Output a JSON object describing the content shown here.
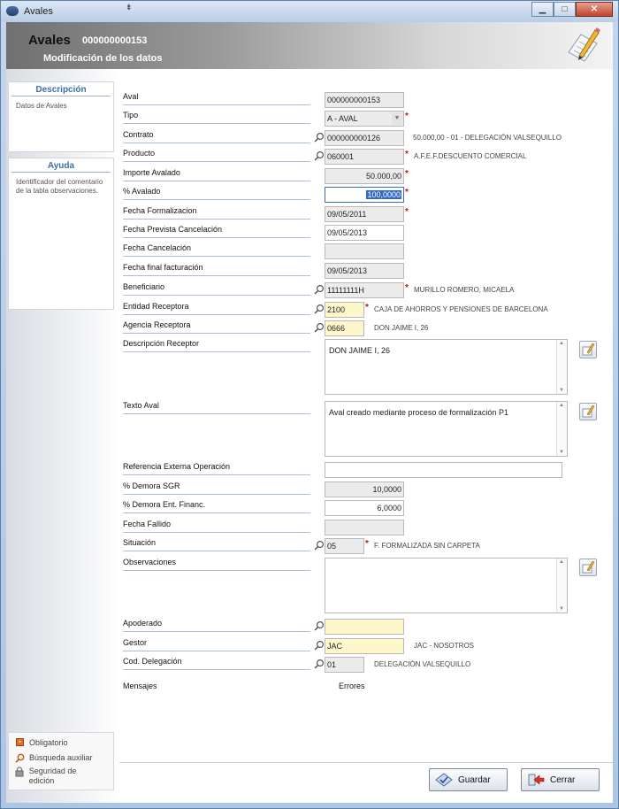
{
  "window": {
    "title": "Avales"
  },
  "header": {
    "title": "Avales",
    "id": "000000000153",
    "subtitle": "Modificación de los datos"
  },
  "sidebar": {
    "descripcion": {
      "title": "Descripción",
      "text": "Datos de Avales"
    },
    "ayuda": {
      "title": "Ayuda",
      "text": "Identificador del comentario de la tabla observaciones."
    },
    "legend": {
      "obligatorio": "Obligatorio",
      "busqueda": "Búsqueda auxiliar",
      "seguridad": "Seguridad de edición"
    }
  },
  "form": {
    "aval": {
      "label": "Aval",
      "value": "000000000153"
    },
    "tipo": {
      "label": "Tipo",
      "value": "A - AVAL"
    },
    "contrato": {
      "label": "Contrato",
      "value": "000000000126",
      "desc": "50.000,00 - 01 - DELEGACIÓN VALSEQUILLO"
    },
    "producto": {
      "label": "Producto",
      "value": "060001",
      "desc": "A.F.E.F.DESCUENTO COMERCIAL"
    },
    "importe_avalado": {
      "label": "Importe Avalado",
      "value": "50.000,00"
    },
    "pct_avalado": {
      "label": "% Avalado",
      "value": "100,0000"
    },
    "fecha_formalizacion": {
      "label": "Fecha Formalizacion",
      "value": "09/05/2011"
    },
    "fecha_prevista_cancelacion": {
      "label": "Fecha Prevista Cancelación",
      "value": "09/05/2013"
    },
    "fecha_cancelacion": {
      "label": "Fecha Cancelación",
      "value": ""
    },
    "fecha_final_facturacion": {
      "label": "Fecha final facturación",
      "value": "09/05/2013"
    },
    "beneficiario": {
      "label": "Beneficiario",
      "value": "11111111H",
      "desc": "MURILLO ROMERO, MICAELA"
    },
    "entidad_receptora": {
      "label": "Entidad Receptora",
      "value": "2100",
      "desc": "CAJA DE AHORROS Y PENSIONES DE BARCELONA"
    },
    "agencia_receptora": {
      "label": "Agencia Receptora",
      "value": "0666",
      "desc": "DON JAIME I, 26"
    },
    "descripcion_receptor": {
      "label": "Descripción Receptor",
      "value": "DON JAIME I, 26"
    },
    "texto_aval": {
      "label": "Texto Aval",
      "value": "Aval creado mediante proceso de formalización P1"
    },
    "referencia_externa": {
      "label": "Referencia Externa Operación",
      "value": ""
    },
    "demora_sgr": {
      "label": "% Demora SGR",
      "value": "10,0000"
    },
    "demora_ent": {
      "label": "% Demora Ent. Financ.",
      "value": "6,0000"
    },
    "fecha_fallido": {
      "label": "Fecha Fallido",
      "value": ""
    },
    "situacion": {
      "label": "Situación",
      "value": "05",
      "desc": "F. FORMALIZADA SIN CARPETA"
    },
    "observaciones": {
      "label": "Observaciones",
      "value": ""
    },
    "apoderado": {
      "label": "Apoderado",
      "value": ""
    },
    "gestor": {
      "label": "Gestor",
      "value": "JAC",
      "desc": "JAC - NOSOTROS"
    },
    "cod_delegacion": {
      "label": "Cod. Delegación",
      "value": "01",
      "desc": "DELEGACIÓN VALSEQUILLO"
    },
    "mensajes": {
      "label": "Mensajes"
    },
    "errores": {
      "label": "Errores"
    }
  },
  "required_mark": "*",
  "buttons": {
    "guardar": "Guardar",
    "cerrar": "Cerrar"
  },
  "colors": {
    "required": "#d01010",
    "lookup_field": "#fff7cc",
    "readonly_field": "#ececec",
    "accent": "#3b6fa8"
  }
}
